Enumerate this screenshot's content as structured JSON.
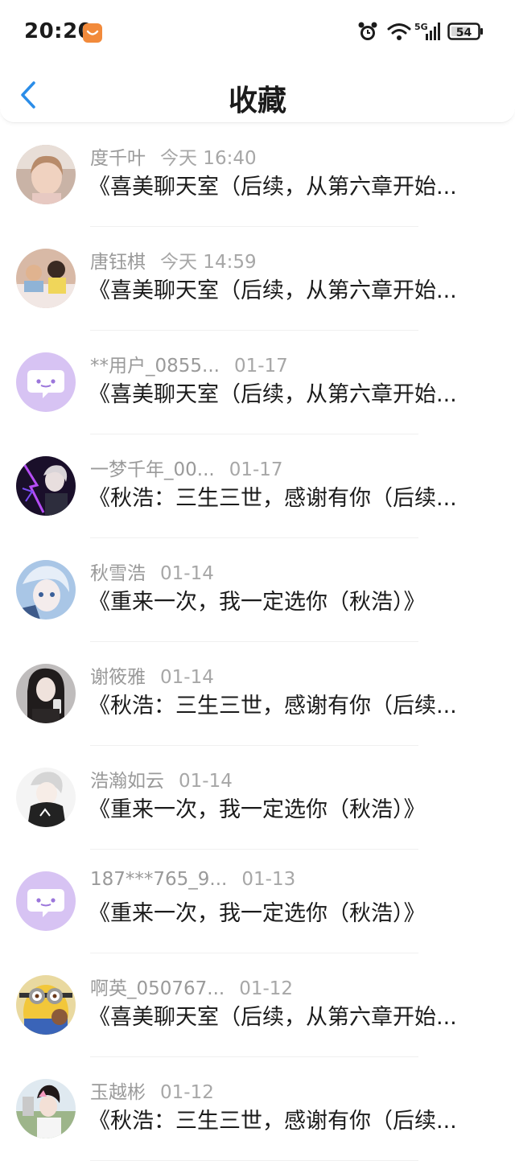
{
  "status_bar": {
    "time": "20:20",
    "battery": "54",
    "network_label": "5G",
    "icons": [
      "app-badge-icon",
      "alarm-icon",
      "wifi-icon",
      "signal-icon",
      "battery-icon"
    ]
  },
  "header": {
    "title": "收藏",
    "back_icon": "chevron-left-icon"
  },
  "colors": {
    "accent": "#2b8de8",
    "text_primary": "#1b1b1b",
    "text_secondary": "#9a9a9a",
    "default_avatar_bg": "#d7c3f3",
    "default_avatar_fg": "#9b76db"
  },
  "items": [
    {
      "user": "度千叶",
      "time": "今天 16:40",
      "title": "《喜美聊天室（后续，从第六章开始...",
      "avatar": "photo-girl"
    },
    {
      "user": "唐钰棋",
      "time": "今天 14:59",
      "title": "《喜美聊天室（后续，从第六章开始...",
      "avatar": "photo-kids"
    },
    {
      "user": "**用户_0855...",
      "time": "01-17",
      "title": "《喜美聊天室（后续，从第六章开始...",
      "avatar": "default-chat"
    },
    {
      "user": "一梦千年_00...",
      "time": "01-17",
      "title": "《秋浩：三生三世，感谢有你（后续...",
      "avatar": "photo-lightning"
    },
    {
      "user": "秋雪浩",
      "time": "01-14",
      "title": "《重来一次，我一定选你（秋浩）》",
      "avatar": "anime-blue"
    },
    {
      "user": "谢筱雅",
      "time": "01-14",
      "title": "《秋浩：三生三世，感谢有你（后续...",
      "avatar": "photo-woman"
    },
    {
      "user": "浩瀚如云",
      "time": "01-14",
      "title": "《重来一次，我一定选你（秋浩）》",
      "avatar": "anime-hoodie"
    },
    {
      "user": "187***765_9...",
      "time": "01-13",
      "title": "《重来一次，我一定选你（秋浩）》",
      "avatar": "default-chat"
    },
    {
      "user": "啊英_050767...",
      "time": "01-12",
      "title": "《喜美聊天室（后续，从第六章开始...",
      "avatar": "minion"
    },
    {
      "user": "玉越彬",
      "time": "01-12",
      "title": "《秋浩：三生三世，感谢有你（后续...",
      "avatar": "photo-outdoor"
    }
  ]
}
